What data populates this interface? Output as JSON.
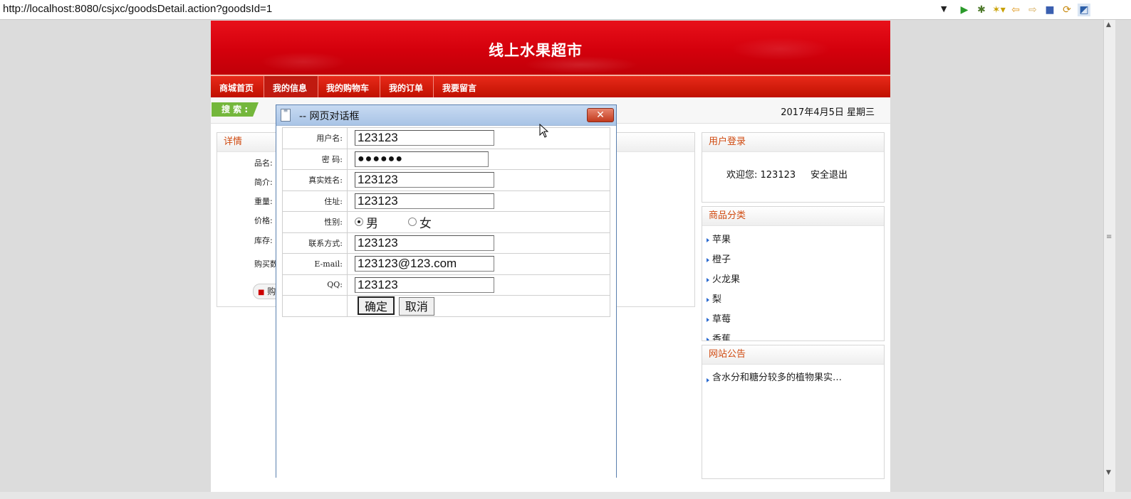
{
  "browser": {
    "url": "http://localhost:8080/csjxc/goodsDetail.action?goodsId=1",
    "toolbar_icons": [
      "run-icon",
      "debug-icon",
      "external-tools-icon",
      "back-icon",
      "forward-icon",
      "stop-icon",
      "sync-icon",
      "perspective-icon"
    ]
  },
  "site": {
    "title": "线上水果超市",
    "nav": [
      "商城首页",
      "我的信息",
      "我的购物车",
      "我的订单",
      "我要留言"
    ],
    "search_label": "搜 索 :",
    "date": "2017年4月5日  星期三"
  },
  "detail": {
    "heading": "详情",
    "labels": [
      "品名:",
      "简介:",
      "重量:",
      "价格:",
      "库存:",
      "购买数"
    ],
    "buy_label": "购"
  },
  "login": {
    "heading": "用户登录",
    "welcome": "欢迎您: 123123",
    "logout": "安全退出"
  },
  "categories": {
    "heading": "商品分类",
    "items": [
      "苹果",
      "橙子",
      "火龙果",
      "梨",
      "草莓",
      "香蕉"
    ]
  },
  "notice": {
    "heading": "网站公告",
    "items": [
      "含水分和糖分较多的植物果实…"
    ]
  },
  "dialog": {
    "title": "-- 网页对话框",
    "fields": {
      "username": {
        "label": "用户名:",
        "value": "123123"
      },
      "password": {
        "label": "密  码:",
        "value": "●●●●●●"
      },
      "realname": {
        "label": "真实姓名:",
        "value": "123123"
      },
      "address": {
        "label": "住址:",
        "value": "123123"
      },
      "gender": {
        "label": "性别:",
        "options": [
          "男",
          "女"
        ],
        "selected": "男"
      },
      "phone": {
        "label": "联系方式:",
        "value": "123123"
      },
      "email": {
        "label": "E-mail:",
        "value": "123123@123.com"
      },
      "qq": {
        "label": "QQ:",
        "value": "123123"
      }
    },
    "confirm": "确定",
    "cancel": "取消"
  },
  "colors": {
    "banner_red": "#d4000c",
    "nav_red": "#c01000",
    "accent_orange": "#d04a10",
    "search_green": "#74b73c",
    "dialog_title_blue": "#a9c4e6"
  }
}
